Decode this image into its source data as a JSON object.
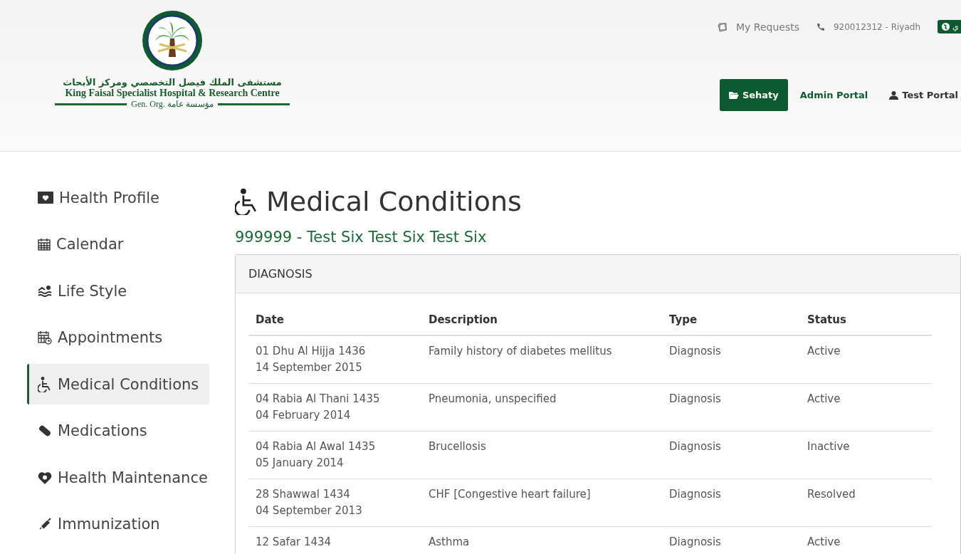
{
  "header": {
    "logo": {
      "arabic_name": "مستشفى الملك فيصل التخصصي ومركز الأبحاث",
      "english_name": "King Faisal Specialist Hospital & Research Centre",
      "org_label": "Gen. Org. مؤسسة عامة"
    },
    "top_links": [
      {
        "kind": "requests",
        "label": "My Requests"
      },
      {
        "kind": "phone",
        "label": "920012312 - Riyadh"
      }
    ],
    "language_button": "ي",
    "portals": [
      {
        "kind": "folder",
        "label": "Sehaty",
        "selected": true
      },
      {
        "kind": "none",
        "label": "Admin Portal",
        "selected": false
      },
      {
        "kind": "user",
        "label": "Test Portal",
        "selected": false
      }
    ]
  },
  "sidebar": {
    "items": [
      {
        "kind": "profile",
        "label": "Health Profile",
        "selected": false
      },
      {
        "kind": "calendar",
        "label": "Calendar",
        "selected": false
      },
      {
        "kind": "swim",
        "label": "Life Style",
        "selected": false
      },
      {
        "kind": "appointments",
        "label": "Appointments",
        "selected": false
      },
      {
        "kind": "wheelchair",
        "label": "Medical Conditions",
        "selected": true
      },
      {
        "kind": "pill",
        "label": "Medications",
        "selected": false
      },
      {
        "kind": "heart",
        "label": "Health Maintenance",
        "selected": false
      },
      {
        "kind": "syringe",
        "label": "Immunization",
        "selected": false
      }
    ]
  },
  "page": {
    "title": "Medical Conditions",
    "patient": "999999 - Test Six Test Six Test Six"
  },
  "diagnosis": {
    "heading": "DIAGNOSIS",
    "columns": [
      "Date",
      "Description",
      "Type",
      "Status"
    ],
    "rows": [
      {
        "date": [
          "01 Dhu Al Hijja 1436",
          "14 September 2015"
        ],
        "description": "Family history of diabetes mellitus",
        "type": "Diagnosis",
        "status": "Active"
      },
      {
        "date": [
          "04 Rabia Al Thani 1435",
          "04 February 2014"
        ],
        "description": "Pneumonia, unspecified",
        "type": "Diagnosis",
        "status": "Active"
      },
      {
        "date": [
          "04 Rabia Al Awal 1435",
          "05 January 2014"
        ],
        "description": "Brucellosis",
        "type": "Diagnosis",
        "status": "Inactive"
      },
      {
        "date": [
          "28 Shawwal 1434",
          "04 September 2013"
        ],
        "description": "CHF [Congestive heart failure]",
        "type": "Diagnosis",
        "status": "Resolved"
      },
      {
        "date": [
          "12 Safar 1434"
        ],
        "description": "Asthma",
        "type": "Diagnosis",
        "status": "Active"
      }
    ]
  }
}
